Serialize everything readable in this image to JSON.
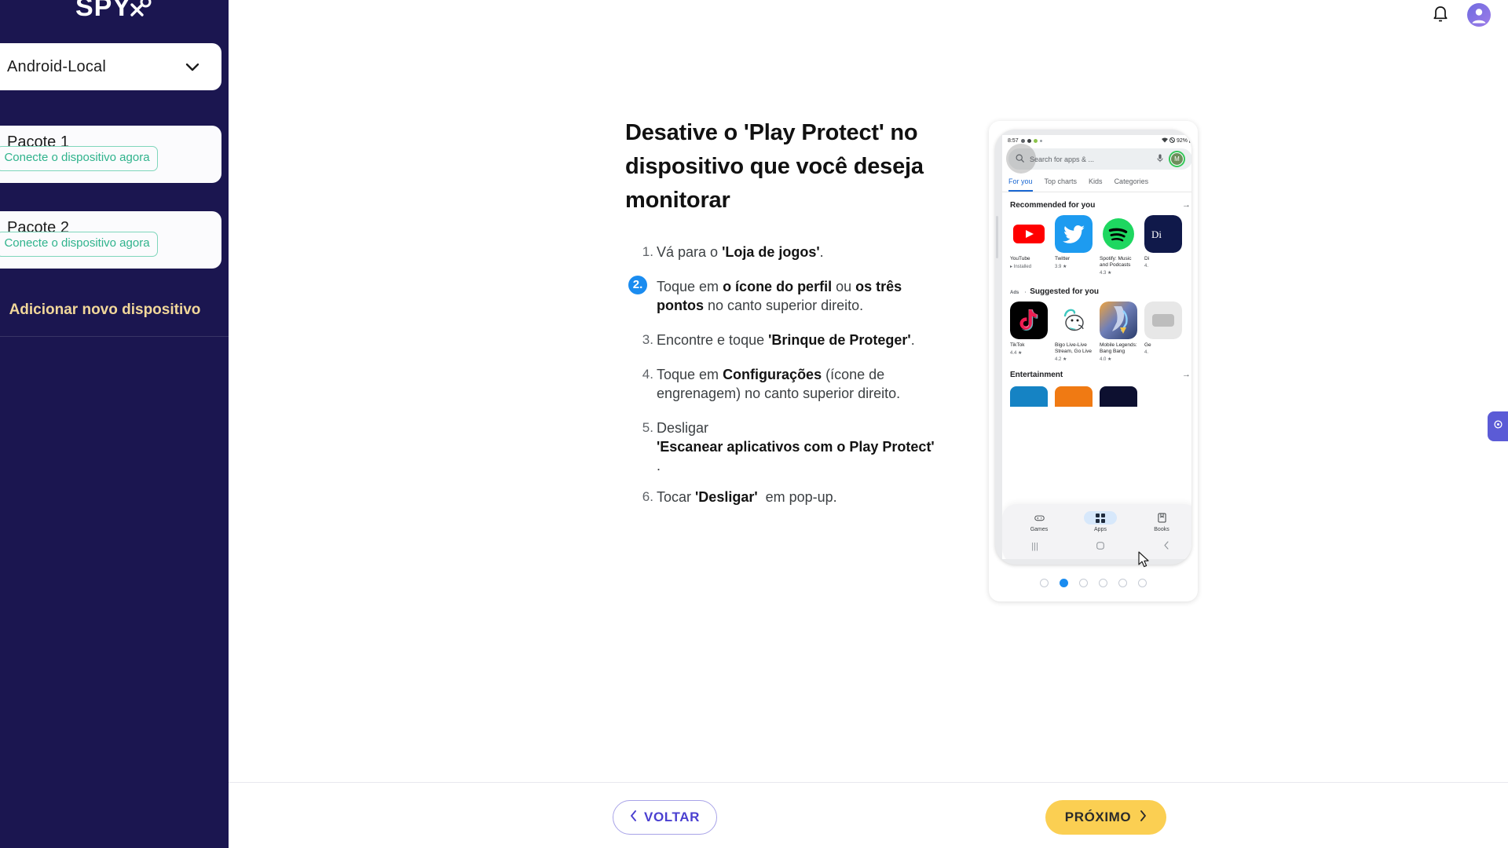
{
  "brand": {
    "name": "SPY",
    "logo_mark": "spy-logo-icon"
  },
  "sidebar": {
    "device_selector": {
      "value": "Android-Local",
      "chevron": "chevron-down-icon"
    },
    "packages": [
      {
        "title": "Pacote 1",
        "connect_label": "Conecte o dispositivo agora"
      },
      {
        "title": "Pacote 2",
        "connect_label": "Conecte o dispositivo agora"
      }
    ],
    "add_device_label": "Adicionar novo dispositivo"
  },
  "topbar": {
    "bell": "bell-icon",
    "avatar": "user-avatar-icon"
  },
  "main": {
    "headline": "Desative o 'Play Protect' no dispositivo que você deseja monitorar",
    "steps": [
      {
        "n": 1,
        "highlight": false,
        "html": "Vá para o <span class='q'>'Loja de jogos'</span>."
      },
      {
        "n": 2,
        "highlight": true,
        "html": "Toque em <b>o ícone do perfil</b> ou <b>os três pontos</b> no canto superior direito."
      },
      {
        "n": 3,
        "highlight": false,
        "html": "Encontre e toque <span class='q'>'Brinque de Proteger'</span>."
      },
      {
        "n": 4,
        "highlight": false,
        "html": "Toque em <b>Configurações</b> (ícone de engrenagem) no canto superior direito."
      },
      {
        "n": 5,
        "highlight": false,
        "html": "Desligar<br><b>'Escanear aplicativos com o Play Protect'</b><br><span class='dot-line'>.</span>"
      },
      {
        "n": 6,
        "highlight": false,
        "html": "Tocar <b>'Desligar'</b>&nbsp; em pop-up."
      }
    ]
  },
  "phone": {
    "status": {
      "time": "8:57",
      "battery": "92%"
    },
    "search_placeholder": "Search for apps & ...",
    "search_icon": "search-icon",
    "mic_icon": "microphone-icon",
    "account_initial": "M",
    "tabs": [
      {
        "label": "For you",
        "active": true
      },
      {
        "label": "Top charts",
        "active": false
      },
      {
        "label": "Kids",
        "active": false
      },
      {
        "label": "Categories",
        "active": false
      }
    ],
    "sections": [
      {
        "title": "Recommended for you",
        "arrow": "arrow-right-icon"
      },
      {
        "ads_tag": "Ads",
        "separator": "·",
        "title": "Suggested for you",
        "arrow": ""
      },
      {
        "title": "Entertainment",
        "arrow": "arrow-right-icon"
      }
    ],
    "recommended": [
      {
        "name": "YouTube",
        "meta": "Installed",
        "installed": true,
        "color": "#ffffff",
        "icon": "youtube-icon"
      },
      {
        "name": "Twitter",
        "meta": "3.9 ★",
        "installed": false,
        "color": "#1d9bf0",
        "icon": "twitter-icon"
      },
      {
        "name": "Spotify: Music and Podcasts",
        "meta": "4.3 ★",
        "installed": false,
        "color": "#1ed760",
        "icon": "spotify-icon"
      },
      {
        "name": "Di",
        "meta": "4.",
        "installed": false,
        "color": "#1b3a8f",
        "icon": "disney-icon"
      }
    ],
    "suggested": [
      {
        "name": "TikTok",
        "meta": "4.4 ★",
        "color": "#010101",
        "icon": "tiktok-icon"
      },
      {
        "name": "Bigo Live-Live Stream, Go Live",
        "meta": "4.2 ★",
        "color": "#ffffff",
        "icon": "bigo-live-icon"
      },
      {
        "name": "Mobile Legends: Bang Bang",
        "meta": "4.0 ★",
        "color": "#4b5f86",
        "icon": "mobile-legends-icon"
      },
      {
        "name": "Ge",
        "meta": "4.",
        "color": "#e7e7e7",
        "icon": "game-icon"
      }
    ],
    "entertainment": [
      {
        "color": "#1583c4"
      },
      {
        "color": "#f07a13"
      },
      {
        "color": "#0d1030"
      }
    ],
    "bottom_nav": [
      {
        "label": "Games",
        "icon": "gamepad-icon",
        "active": false
      },
      {
        "label": "Apps",
        "icon": "apps-grid-icon",
        "active": true
      },
      {
        "label": "Books",
        "icon": "book-icon",
        "active": false
      }
    ],
    "system_nav": [
      {
        "icon": "recents-icon"
      },
      {
        "icon": "home-icon"
      },
      {
        "icon": "back-icon"
      }
    ],
    "cursor": "mouse-pointer-icon"
  },
  "pagination": {
    "total": 6,
    "active_index": 1
  },
  "footer": {
    "back_label": "VOLTAR",
    "back_icon": "chevron-left-icon",
    "next_label": "PRÓXIMO",
    "next_icon": "chevron-right-icon"
  },
  "side_tab": {
    "icon": "support-icon"
  },
  "colors": {
    "sidebar_bg": "#1b1650",
    "accent_yellow": "#fbcf52",
    "accent_gold_text": "#f1d79a",
    "teal": "#2fb38c",
    "blue_highlight": "#1a8cf0",
    "purple": "#5b5bd6"
  }
}
